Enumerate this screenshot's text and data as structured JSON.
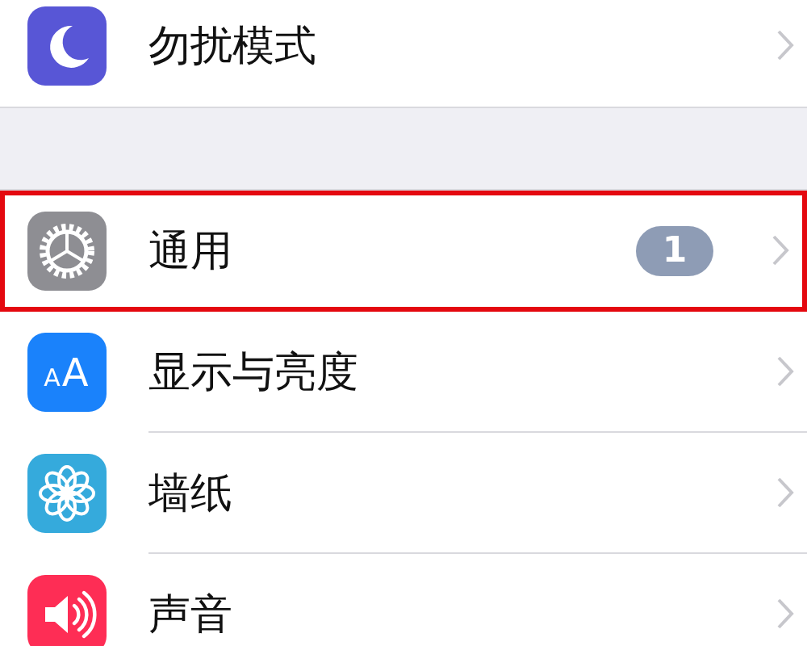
{
  "sections": [
    {
      "rows": [
        {
          "kind": "moon",
          "label": "勿扰模式",
          "highlighted": false
        }
      ]
    },
    {
      "rows": [
        {
          "kind": "gear",
          "label": "通用",
          "highlighted": true,
          "badge": "1"
        },
        {
          "kind": "text-size",
          "icon_text": "AA",
          "label": "显示与亮度",
          "highlighted": false
        },
        {
          "kind": "flower",
          "label": "墙纸",
          "highlighted": false
        },
        {
          "kind": "speaker",
          "label": "声音",
          "highlighted": false
        }
      ]
    }
  ]
}
